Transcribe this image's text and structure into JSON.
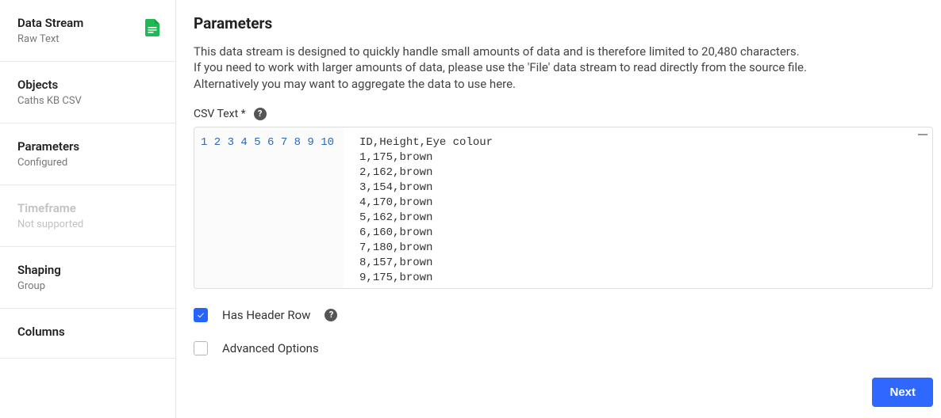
{
  "sidebar": {
    "items": [
      {
        "title": "Data Stream",
        "sub": "Raw Text",
        "icon": "file-icon",
        "disabled": false
      },
      {
        "title": "Objects",
        "sub": "Caths KB CSV",
        "disabled": false
      },
      {
        "title": "Parameters",
        "sub": "Configured",
        "disabled": false
      },
      {
        "title": "Timeframe",
        "sub": "Not supported",
        "disabled": true
      },
      {
        "title": "Shaping",
        "sub": "Group",
        "disabled": false
      },
      {
        "title": "Columns",
        "sub": "",
        "disabled": false
      }
    ]
  },
  "main": {
    "heading": "Parameters",
    "description_line1": "This data stream is designed to quickly handle small amounts of data and is therefore limited to 20,480 characters.",
    "description_line2": "If you need to work with larger amounts of data, please use the 'File' data stream to read directly from the source file.",
    "description_line3": "Alternatively you may want to aggregate the data to use here.",
    "csv_label": "CSV Text *",
    "csv_lines": [
      "ID,Height,Eye colour",
      "1,175,brown",
      "2,162,brown",
      "3,154,brown",
      "4,170,brown",
      "5,162,brown",
      "6,160,brown",
      "7,180,brown",
      "8,157,brown",
      "9,175,brown"
    ],
    "has_header_label": "Has Header Row",
    "has_header_checked": true,
    "advanced_label": "Advanced Options",
    "advanced_checked": false,
    "next_label": "Next"
  }
}
